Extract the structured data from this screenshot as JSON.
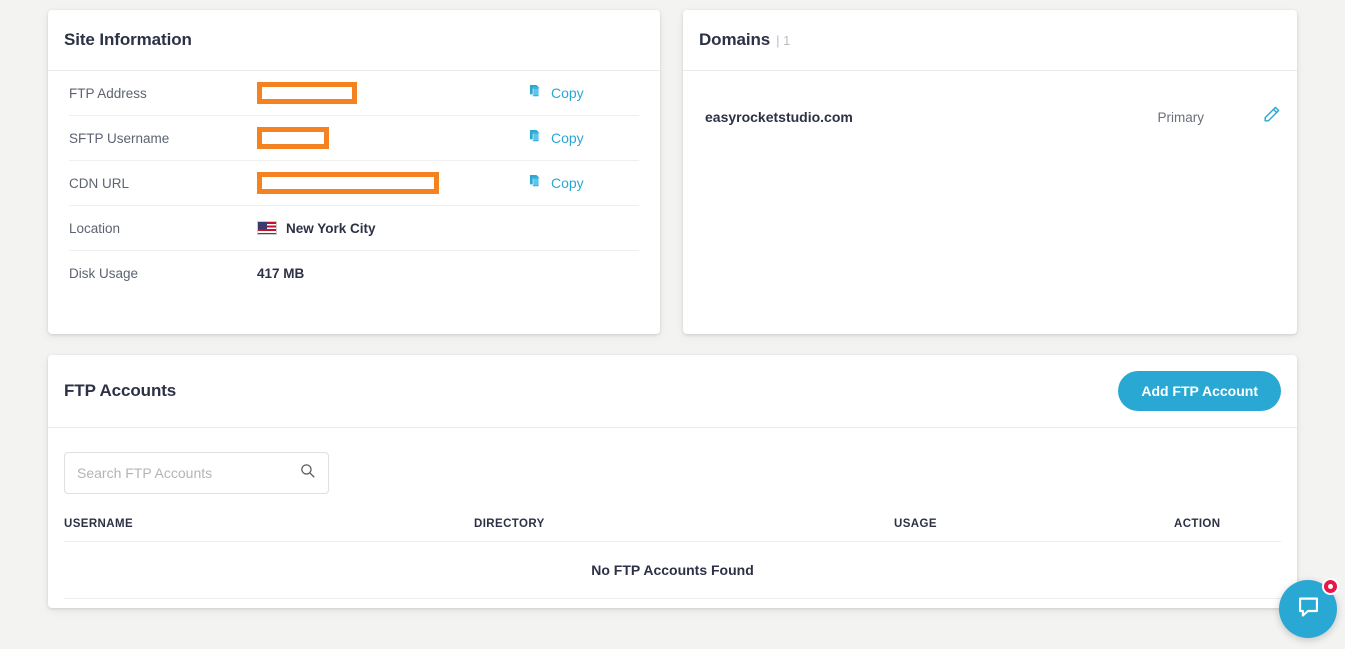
{
  "site_information": {
    "title": "Site Information",
    "rows": [
      {
        "label": "FTP Address",
        "value": "",
        "redacted": true,
        "action": "Copy",
        "icon": "copy-icon"
      },
      {
        "label": "SFTP Username",
        "value": "",
        "redacted": true,
        "action": "Copy",
        "icon": "copy-icon"
      },
      {
        "label": "CDN URL",
        "value": "",
        "redacted": true,
        "action": "Copy",
        "icon": "copy-icon"
      },
      {
        "label": "Location",
        "value": "New York City",
        "redacted": false,
        "icon": "us-flag-icon"
      },
      {
        "label": "Disk Usage",
        "value": "417 MB",
        "redacted": false
      }
    ]
  },
  "domains": {
    "title": "Domains",
    "count": "| 1",
    "rows": [
      {
        "name": "easyrocketstudio.com",
        "status": "Primary",
        "action_icon": "pencil-edit-icon"
      }
    ]
  },
  "ftp_accounts": {
    "title": "FTP Accounts",
    "add_button": "Add FTP Account",
    "search_placeholder": "Search FTP Accounts",
    "search_value": "",
    "columns": [
      "USERNAME",
      "DIRECTORY",
      "USAGE",
      "ACTION"
    ],
    "empty_message": "No FTP Accounts Found",
    "rows": []
  },
  "chat_widget": {
    "icon": "chat-bubble-icon",
    "badge": ""
  },
  "colors": {
    "accent_cyan": "#2aa8d4",
    "redaction_orange": "#f58220",
    "badge_red": "#e8174a",
    "text_dark": "#2c3145",
    "page_background": "#f3f3f2"
  }
}
